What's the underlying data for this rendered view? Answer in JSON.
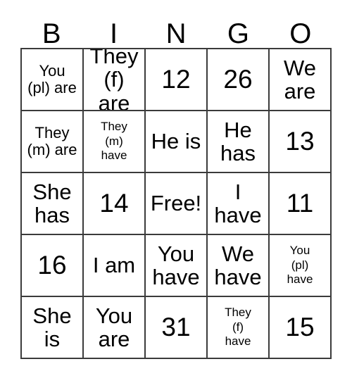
{
  "card": {
    "title_letters": [
      "B",
      "I",
      "N",
      "G",
      "O"
    ],
    "free_space_label": "Free!",
    "columns": 5,
    "rows": 5,
    "border_color": "#3b3b3b",
    "background_color": "#ffffff",
    "text_color": "#000000",
    "cells": [
      [
        {
          "text": "You\n(pl) are",
          "size": "md"
        },
        {
          "text": "They\n(f) are",
          "size": "lg"
        },
        {
          "text": "12",
          "size": "xl"
        },
        {
          "text": "26",
          "size": "xl"
        },
        {
          "text": "We\nare",
          "size": "lg"
        }
      ],
      [
        {
          "text": "They\n(m) are",
          "size": "md"
        },
        {
          "text": "They\n(m)\nhave",
          "size": "sm"
        },
        {
          "text": "He is",
          "size": "lg"
        },
        {
          "text": "He\nhas",
          "size": "lg"
        },
        {
          "text": "13",
          "size": "xl"
        }
      ],
      [
        {
          "text": "She\nhas",
          "size": "lg"
        },
        {
          "text": "14",
          "size": "xl"
        },
        {
          "text": "Free!",
          "size": "lg"
        },
        {
          "text": "I\nhave",
          "size": "lg"
        },
        {
          "text": "11",
          "size": "xl"
        }
      ],
      [
        {
          "text": "16",
          "size": "xl"
        },
        {
          "text": "I am",
          "size": "lg"
        },
        {
          "text": "You\nhave",
          "size": "lg"
        },
        {
          "text": "We\nhave",
          "size": "lg"
        },
        {
          "text": "You\n(pl)\nhave",
          "size": "sm"
        }
      ],
      [
        {
          "text": "She\nis",
          "size": "lg"
        },
        {
          "text": "You\nare",
          "size": "lg"
        },
        {
          "text": "31",
          "size": "xl"
        },
        {
          "text": "They\n(f)\nhave",
          "size": "sm"
        },
        {
          "text": "15",
          "size": "xl"
        }
      ]
    ]
  }
}
